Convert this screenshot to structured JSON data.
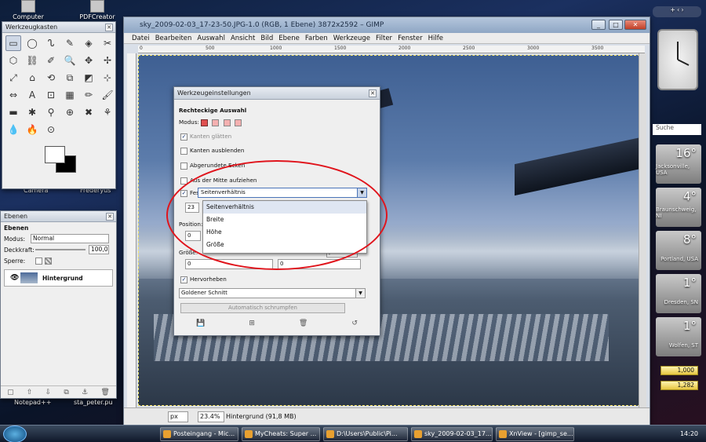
{
  "desktop": {
    "icons": [
      "Computer",
      "PDFCreator"
    ],
    "side_labels": [
      "Camera",
      "Frederyus",
      "Notepad++",
      "sta_peter.pu"
    ]
  },
  "gimp": {
    "title": "sky_2009-02-03_17-23-50.JPG-1.0 (RGB, 1 Ebene) 3872x2592 – GIMP",
    "menu": [
      "Datei",
      "Bearbeiten",
      "Auswahl",
      "Ansicht",
      "Bild",
      "Ebene",
      "Farben",
      "Werkzeuge",
      "Filter",
      "Fenster",
      "Hilfe"
    ],
    "ruler_ticks": [
      "0",
      "500",
      "1000",
      "1500",
      "2000",
      "2500",
      "3000",
      "3500"
    ],
    "status": {
      "unit": "px",
      "zoom": "23.4%",
      "layer": "Hintergrund (91,8 MB)"
    }
  },
  "toolbox": {
    "title": "Werkzeugkasten",
    "tools": [
      "▭",
      "◯",
      "ᔐ",
      "✎",
      "◈",
      "✂",
      "⬡",
      "⛓",
      "✐",
      "🔍",
      "✥",
      "✢",
      "⤢",
      "⌂",
      "⟲",
      "⧉",
      "◩",
      "⊹",
      "⇔",
      "A",
      "⊡",
      "▦",
      "✏",
      "🖌",
      "▬",
      "✱",
      "⚲",
      "⊕",
      "✖",
      "⚘",
      "💧",
      "🔥",
      "⊙"
    ]
  },
  "layers": {
    "title": "Ebenen",
    "subtitle": "Ebenen",
    "modus_label": "Modus:",
    "modus_value": "Normal",
    "deckkraft_label": "Deckkraft:",
    "deckkraft_value": "100,0",
    "sperre_label": "Sperre:",
    "layer_name": "Hintergrund"
  },
  "toolopts": {
    "title": "Werkzeugeinstellungen",
    "heading": "Rechteckige Auswahl",
    "modus": "Modus:",
    "options": [
      "Kanten glätten",
      "Kanten ausblenden",
      "Abgerundete Ecken",
      "Aus der Mitte aufziehen"
    ],
    "fest_label": "Fest:",
    "fest_value": "Seitenverhältnis",
    "field_23": "23",
    "position_label": "Position:",
    "position_x": "0",
    "position_unit": "px",
    "groesse_label": "Größe:",
    "groesse_a": "0",
    "groesse_b": "0",
    "popup": [
      "Seitenverhältnis",
      "Breite",
      "Höhe",
      "Größe"
    ],
    "hervorheben": "Hervorheben",
    "guides": "Goldener Schnitt",
    "shrink": "Automatisch schrumpfen"
  },
  "sidebar": {
    "search": "Suche",
    "weather": [
      {
        "temp": "16°",
        "city": "Jacksonville, USA"
      },
      {
        "temp": "4°",
        "city": "Braunschweig, NI"
      },
      {
        "temp": "8°",
        "city": "Portland, USA"
      },
      {
        "temp": "1°",
        "city": "Dresden, SN"
      },
      {
        "temp": "1°",
        "city": "Wolfen, ST"
      }
    ],
    "currency": [
      "1,000",
      "1,282"
    ]
  },
  "taskbar": {
    "items": [
      "Posteingang - Mic...",
      "MyCheats: Super ...",
      "D:\\Users\\Public\\Pi...",
      "sky_2009-02-03_17...",
      "XnView - [gimp_se..."
    ],
    "time": "14:20"
  },
  "colors": {
    "accent": "#4a74b8",
    "annotation": "#e0141c",
    "titlebar": "#8ea6c4"
  }
}
